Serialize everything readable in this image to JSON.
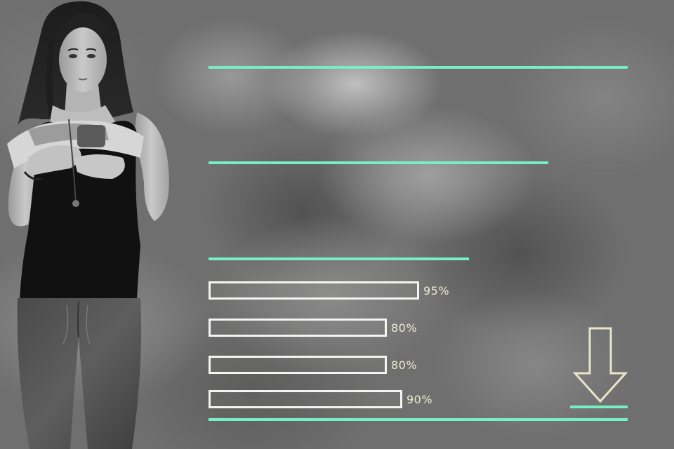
{
  "accent_color": "#78eec4",
  "bar_outline_color": "#f4f4f0",
  "label_color": "#ecebd0",
  "photo": {
    "subject": "woman-holding-snacks",
    "style": "black-and-white"
  },
  "skills": [
    {
      "level": 95,
      "label": "95%"
    },
    {
      "level": 80,
      "label": "80%"
    },
    {
      "level": 80,
      "label": "80%"
    },
    {
      "level": 90,
      "label": "90%"
    }
  ],
  "scroll_indicator": {
    "icon": "arrow-down-icon"
  }
}
